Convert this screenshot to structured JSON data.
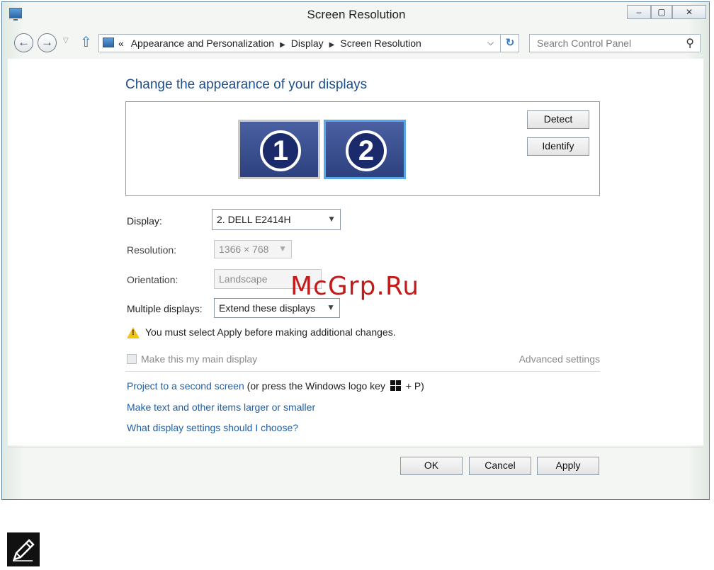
{
  "window": {
    "title": "Screen Resolution",
    "controls": [
      "–",
      "▢",
      "✕"
    ]
  },
  "address_bar": {
    "back_icon": "back-arrow-icon",
    "forward_icon": "forward-arrow-icon",
    "overflow": "«",
    "crumbs": [
      "Appearance and Personalization",
      "Display",
      "Screen Resolution"
    ],
    "search_placeholder": "Search Control Panel"
  },
  "main": {
    "heading": "Change the appearance of your displays",
    "monitors": [
      {
        "number": "1",
        "selected": false
      },
      {
        "number": "2",
        "selected": true
      }
    ],
    "detect_label": "Detect",
    "identify_label": "Identify",
    "display_label": "Display:",
    "display_value": "2. DELL E2414H",
    "resolution_label": "Resolution:",
    "resolution_value": "1366 × 768",
    "orientation_label": "Orientation:",
    "orientation_value": "Landscape",
    "multiple_label": "Multiple displays:",
    "multiple_value": "Extend these displays",
    "warning_text": "You must select Apply before making additional changes.",
    "main_display_label": "Make this my main display",
    "advanced_label": "Advanced settings",
    "link_project": "Project to a second screen",
    "link_project_suffix_a": "(or press the Windows logo key",
    "link_project_suffix_b": "+ P)",
    "link_text_size": "Make text and other items larger or smaller",
    "link_choose": "What display settings should I choose?"
  },
  "footer": {
    "ok": "OK",
    "cancel": "Cancel",
    "apply": "Apply"
  },
  "watermark": "McGrp.Ru",
  "colors": {
    "heading": "#1e4f8a",
    "link": "#1f5fa6",
    "monitor_fill": "#3a4f92",
    "monitor_selected_border": "#59a7e6",
    "watermark": "#c31a1a"
  }
}
